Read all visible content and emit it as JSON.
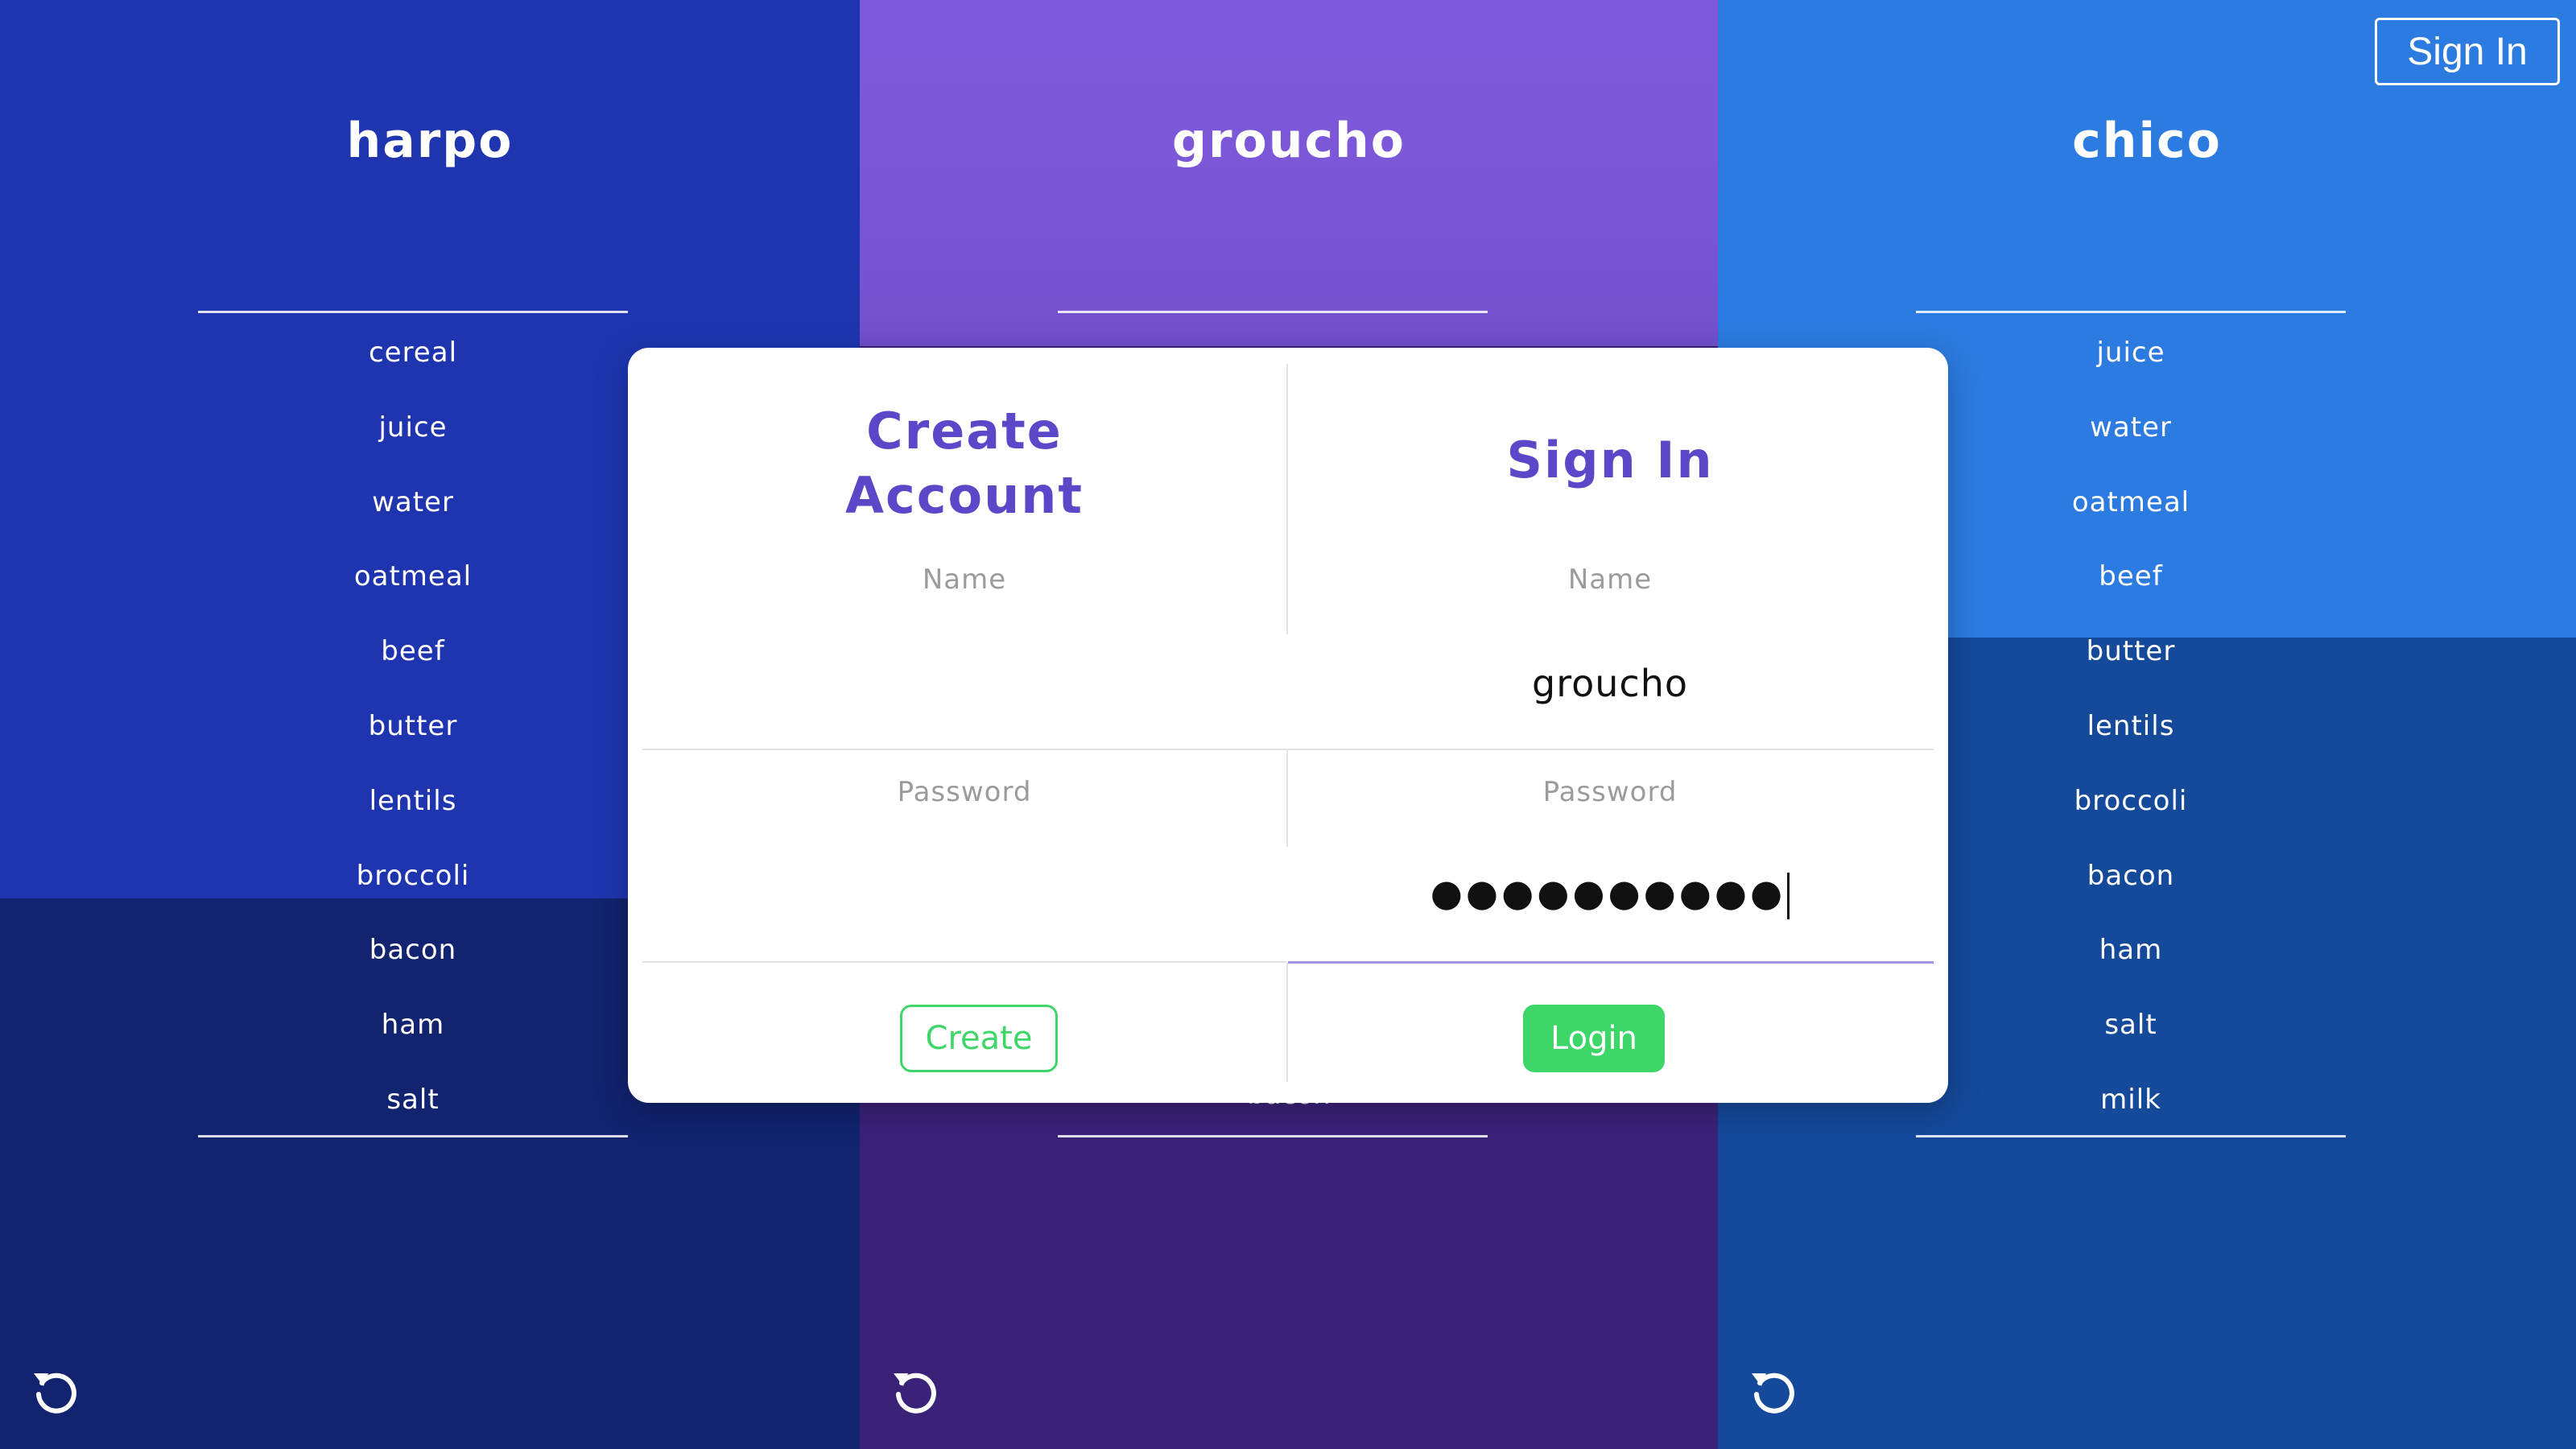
{
  "columns": [
    {
      "title": "harpo",
      "items": [
        "cereal",
        "juice",
        "water",
        "oatmeal",
        "beef",
        "butter",
        "lentils",
        "broccoli",
        "bacon",
        "ham",
        "salt"
      ]
    },
    {
      "title": "groucho",
      "items": [],
      "peek_bottom": "bacon"
    },
    {
      "title": "chico",
      "items": [
        "juice",
        "water",
        "oatmeal",
        "beef",
        "butter",
        "lentils",
        "broccoli",
        "bacon",
        "ham",
        "salt",
        "milk"
      ]
    }
  ],
  "header": {
    "signin_label": "Sign In"
  },
  "modal": {
    "create": {
      "heading_line1": "Create",
      "heading_line2": "Account",
      "name_label": "Name",
      "password_label": "Password",
      "name_value": "",
      "password_value": "",
      "button_label": "Create"
    },
    "signin": {
      "heading": "Sign In",
      "name_label": "Name",
      "password_label": "Password",
      "name_value": "groucho",
      "password_masked": "●●●●●●●●●●",
      "button_label": "Login"
    }
  },
  "icons": {
    "reset": "reset-icon"
  },
  "colors": {
    "harpo": "#1e35af",
    "groucho": "#7e58da",
    "chico": "#2c7be0",
    "accent": "#5b48c9",
    "success": "#3ed668"
  }
}
